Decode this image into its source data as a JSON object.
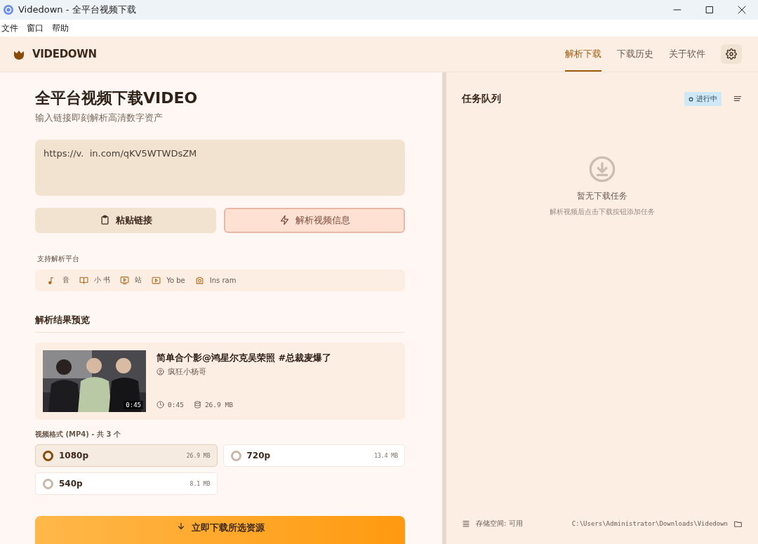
{
  "window": {
    "title": "Videdown - 全平台视频下载"
  },
  "menu": [
    "文件",
    "窗口",
    "帮助"
  ],
  "header": {
    "brand": "VIDEDOWN",
    "tabs": [
      {
        "label": "解析下载",
        "selected": true
      },
      {
        "label": "下载历史",
        "selected": false
      },
      {
        "label": "关于软件",
        "selected": false
      }
    ]
  },
  "main": {
    "title": "全平台视频下载VIDEO",
    "subtitle": "输入链接即刻解析高清数字资产",
    "url": "https://v.  in.com/qKV5WTWDsZM",
    "buttons": [
      {
        "label": "粘贴链接",
        "kind": "paste"
      },
      {
        "label": "解析视频信息",
        "kind": "parse"
      }
    ],
    "platforms_label": "支持解析平台",
    "platforms": [
      {
        "name": "音",
        "kind": "music"
      },
      {
        "name": "小 书",
        "kind": "book"
      },
      {
        "name": "站",
        "kind": "tv"
      },
      {
        "name": "Yo be",
        "kind": "play"
      },
      {
        "name": "Ins ram",
        "kind": "camera"
      }
    ],
    "preview_heading": "解析结果预览",
    "video": {
      "kind": "picture",
      "title": "简单合个影@鸿星尔克吴荣照 #总裁麦爆了",
      "author": "疯狂小杨哥",
      "badge": "0:45",
      "duration": "0:45",
      "size": "26.9 MB"
    },
    "formats_label": "视频格式 (MP4) - 共 3 个",
    "formats": [
      {
        "label": "1080p",
        "size": "26.9 MB",
        "selected": true
      },
      {
        "label": "720p",
        "size": "13.4 MB",
        "selected": false
      },
      {
        "label": "540p",
        "size": "8.1 MB",
        "selected": false
      }
    ],
    "download_button": "立即下载所选资源"
  },
  "queue": {
    "title": "任务队列",
    "status": "进行中",
    "empty_title": "暂无下载任务",
    "empty_hint": "解析视频后点击下载按钮添加任务",
    "storage": "存储空间: 可用",
    "path": "C:\\Users\\Administrator\\Downloads\\Videdown"
  }
}
